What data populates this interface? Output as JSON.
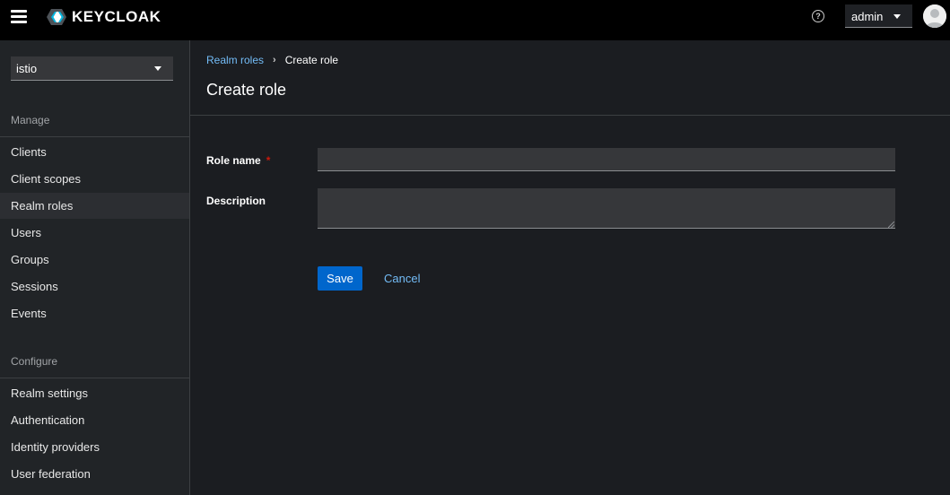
{
  "header": {
    "brand": "KEYCLOAK",
    "help_icon": "?",
    "user_menu_label": "admin"
  },
  "sidebar": {
    "realm": "istio",
    "sections": [
      {
        "title": "Manage",
        "items": [
          "Clients",
          "Client scopes",
          "Realm roles",
          "Users",
          "Groups",
          "Sessions",
          "Events"
        ]
      },
      {
        "title": "Configure",
        "items": [
          "Realm settings",
          "Authentication",
          "Identity providers",
          "User federation"
        ]
      }
    ],
    "active_item": "Realm roles"
  },
  "breadcrumb": {
    "parent": "Realm roles",
    "current": "Create role"
  },
  "page": {
    "title": "Create role"
  },
  "form": {
    "role_name_label": "Role name",
    "required_marker": "*",
    "role_name_value": "",
    "description_label": "Description",
    "description_value": ""
  },
  "actions": {
    "save_label": "Save",
    "cancel_label": "Cancel"
  },
  "colors": {
    "header_bg": "#000000",
    "sidebar_bg": "#212427",
    "main_bg": "#1b1d21",
    "primary": "#0066cc",
    "link": "#73bcf7",
    "required": "#c9190b"
  }
}
